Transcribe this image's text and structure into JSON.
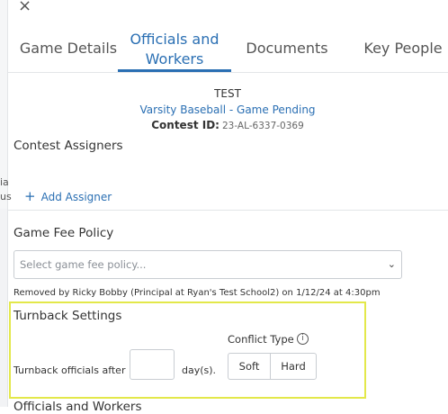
{
  "window": {
    "close_glyph": "×"
  },
  "left_strip": {
    "ghost_a": "ia",
    "ghost_b": "us"
  },
  "tabs": [
    {
      "label": "Game Details"
    },
    {
      "label_line1": "Officials and",
      "label_line2": "Workers",
      "active": true
    },
    {
      "label": "Documents"
    },
    {
      "label": "Key People"
    }
  ],
  "header": {
    "title": "TEST",
    "subtitle": "Varsity Baseball - Game Pending",
    "contest_id_label": "Contest ID:",
    "contest_id_value": "23-AL-6337-0369"
  },
  "contest_assigners": {
    "title": "Contest Assigners",
    "add_label": "Add Assigner"
  },
  "game_fee_policy": {
    "title": "Game Fee Policy",
    "placeholder": "Select game fee policy...",
    "removed_note": "Removed by Ricky Bobby (Principal at Ryan's Test School2) on 1/12/24 at 4:30pm"
  },
  "turnback": {
    "title": "Turnback Settings",
    "label_before": "Turnback officials after",
    "days_value": "",
    "label_after": "day(s).",
    "conflict_type_label": "Conflict Type",
    "options": [
      "Soft",
      "Hard"
    ]
  },
  "next_section_title": "Officials and Workers",
  "colors": {
    "accent": "#2a6fb3",
    "highlight_border": "#e3e84a"
  }
}
